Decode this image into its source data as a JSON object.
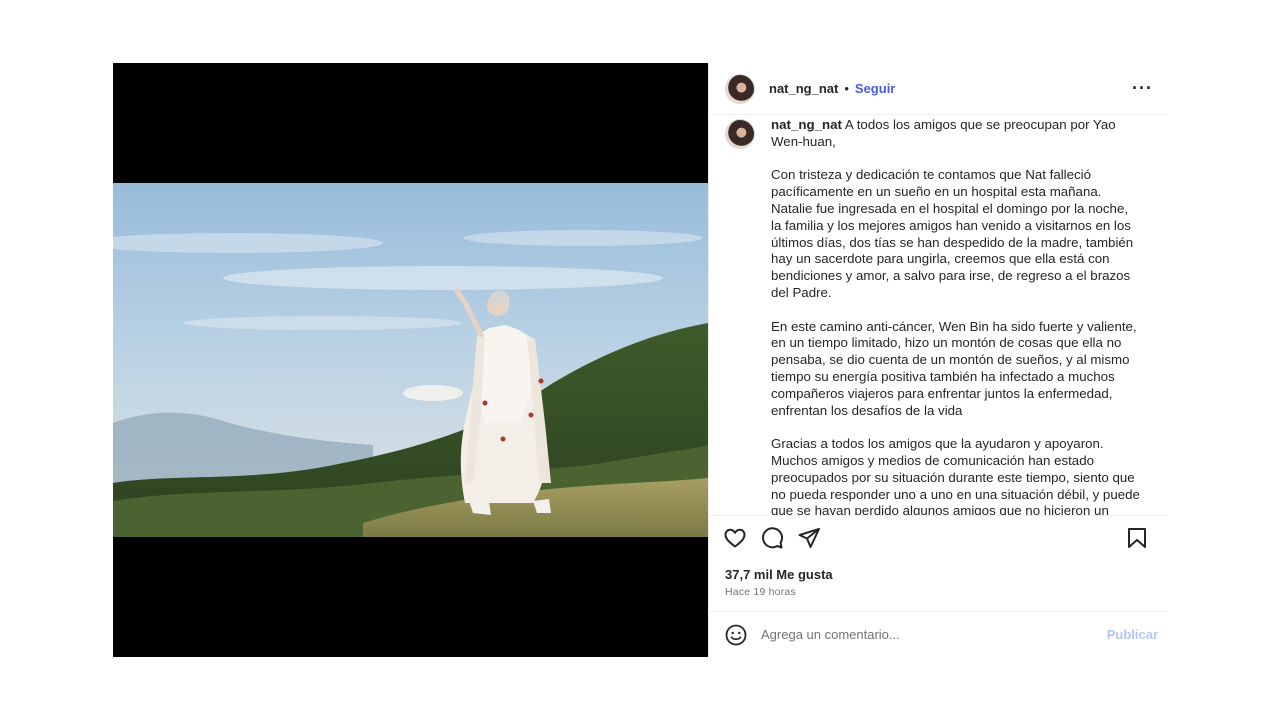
{
  "post": {
    "username": "nat_ng_nat",
    "separator": "•",
    "follow_label": "Seguir",
    "more_icon": "more-horizontal-icon",
    "more_glyph": "···"
  },
  "caption": {
    "username": "nat_ng_nat",
    "paragraphs": [
      "A todos los amigos que se preocupan por Yao Wen-huan,",
      "Con tristeza y dedicación te contamos que Nat falleció pacíficamente en un sueño en un hospital esta mañana. Natalie fue ingresada en el hospital el domingo por la noche, la familia y los mejores amigos han venido a visitarnos en los últimos días, dos tías se han despedido de la madre, también hay un sacerdote para ungirla, creemos que ella está con bendiciones y amor, a salvo para irse, de regreso a el brazos del Padre.",
      "En este camino anti-cáncer, Wen Bin ha sido fuerte y valiente, en un tiempo limitado, hizo un montón de cosas que ella no pensaba, se dio cuenta de un montón de sueños, y al mismo tiempo su energía positiva también ha infectado a muchos compañeros viajeros para enfrentar juntos la enfermedad, enfrentan los desafíos de la vida",
      "Gracias a todos los amigos que la ayudaron y apoyaron. Muchos amigos y medios de comunicación han estado preocupados por su situación durante este tiempo, siento que no pueda responder uno a uno en una situación débil, y puede que se hayan perdido algunos amigos que no hicieron un último aviso. Anunciaremos sus planes más tarde. Los dos mandriles seguirán siendo"
    ]
  },
  "actions": {
    "icons": [
      "heart-icon",
      "comment-icon",
      "share-icon",
      "bookmark-icon"
    ]
  },
  "likes": "37,7 mil Me gusta",
  "timestamp": "Hace 19 horas",
  "comment": {
    "placeholder": "Agrega un comentario...",
    "publish_label": "Publicar",
    "emoji_icon": "emoji-icon"
  },
  "colors": {
    "accent": "#4a5de0",
    "publish_disabled": "#b3c6f5",
    "text": "#262626",
    "muted": "#737373"
  }
}
